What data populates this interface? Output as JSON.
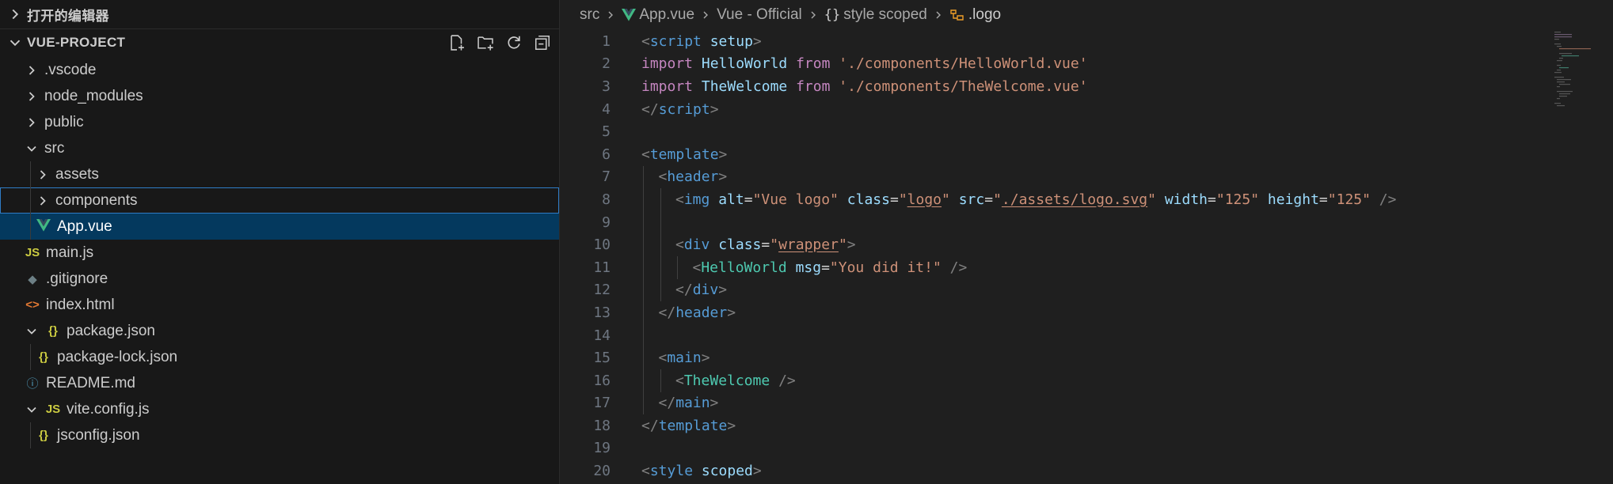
{
  "sidebar": {
    "open_editors_label": "打开的编辑器",
    "project_label": "VUE-PROJECT",
    "tree": [
      {
        "label": ".vscode",
        "indent": 0,
        "kind": "folder",
        "icon": "chevron-right-icon",
        "icon_text": ""
      },
      {
        "label": "node_modules",
        "indent": 0,
        "kind": "folder",
        "icon": "chevron-right-icon",
        "icon_text": ""
      },
      {
        "label": "public",
        "indent": 0,
        "kind": "folder",
        "icon": "chevron-right-icon",
        "icon_text": ""
      },
      {
        "label": "src",
        "indent": 0,
        "kind": "folder-open",
        "icon": "chevron-down-icon",
        "icon_text": ""
      },
      {
        "label": "assets",
        "indent": 1,
        "kind": "folder",
        "icon": "chevron-right-icon",
        "icon_text": ""
      },
      {
        "label": "components",
        "indent": 1,
        "kind": "folder",
        "icon": "chevron-right-icon",
        "icon_text": "",
        "state": "focus"
      },
      {
        "label": "App.vue",
        "indent": 1,
        "kind": "file",
        "icon": "vue-icon",
        "icon_text": "",
        "state": "selected"
      },
      {
        "label": "main.js",
        "indent": 0,
        "kind": "file",
        "icon": "js-icon",
        "icon_text": "JS"
      },
      {
        "label": ".gitignore",
        "indent": 0,
        "kind": "file",
        "icon": "git-icon",
        "icon_text": "◆"
      },
      {
        "label": "index.html",
        "indent": 0,
        "kind": "file",
        "icon": "html-icon",
        "icon_text": "<>"
      },
      {
        "label": "package.json",
        "indent": 0,
        "kind": "file-nested",
        "icon": "json-icon",
        "icon_text": "{}"
      },
      {
        "label": "package-lock.json",
        "indent": 1,
        "kind": "file",
        "icon": "json-icon",
        "icon_text": "{}"
      },
      {
        "label": "README.md",
        "indent": 0,
        "kind": "file",
        "icon": "info-icon",
        "icon_text": "ⓘ"
      },
      {
        "label": "vite.config.js",
        "indent": 0,
        "kind": "file-nested",
        "icon": "js-icon",
        "icon_text": "JS"
      },
      {
        "label": "jsconfig.json",
        "indent": 1,
        "kind": "file",
        "icon": "json-icon",
        "icon_text": "{}"
      }
    ]
  },
  "breadcrumb": {
    "items": [
      "src",
      "App.vue",
      "Vue - Official",
      "style scoped",
      ".logo"
    ]
  },
  "colors": {
    "tag": "#569cd6",
    "punct": "#808080",
    "attr": "#9cdcfe",
    "string": "#ce9178",
    "component": "#4ec9b0",
    "keyword": "#c586c0",
    "ident": "#9cdcfe",
    "plain": "#d4d4d4",
    "vue_green": "#41b883",
    "js_yellow": "#cbcb41",
    "json_yellow": "#cbcb41",
    "html_orange": "#e37933",
    "info_blue": "#519aba"
  },
  "code": {
    "lines": [
      {
        "n": "1",
        "indent": 0,
        "tokens": [
          [
            "punct",
            "<"
          ],
          [
            "tag",
            "script"
          ],
          [
            "plain",
            " "
          ],
          [
            "attr",
            "setup"
          ],
          [
            "punct",
            ">"
          ]
        ]
      },
      {
        "n": "2",
        "indent": 0,
        "tokens": [
          [
            "keyword",
            "import"
          ],
          [
            "plain",
            " "
          ],
          [
            "ident",
            "HelloWorld"
          ],
          [
            "plain",
            " "
          ],
          [
            "keyword",
            "from"
          ],
          [
            "plain",
            " "
          ],
          [
            "string",
            "'./components/HelloWorld.vue'"
          ]
        ]
      },
      {
        "n": "3",
        "indent": 0,
        "tokens": [
          [
            "keyword",
            "import"
          ],
          [
            "plain",
            " "
          ],
          [
            "ident",
            "TheWelcome"
          ],
          [
            "plain",
            " "
          ],
          [
            "keyword",
            "from"
          ],
          [
            "plain",
            " "
          ],
          [
            "string",
            "'./components/TheWelcome.vue'"
          ]
        ]
      },
      {
        "n": "4",
        "indent": 0,
        "tokens": [
          [
            "punct",
            "</"
          ],
          [
            "tag",
            "script"
          ],
          [
            "punct",
            ">"
          ]
        ]
      },
      {
        "n": "5",
        "indent": 0,
        "tokens": []
      },
      {
        "n": "6",
        "indent": 0,
        "tokens": [
          [
            "punct",
            "<"
          ],
          [
            "tag",
            "template"
          ],
          [
            "punct",
            ">"
          ]
        ]
      },
      {
        "n": "7",
        "indent": 1,
        "tokens": [
          [
            "punct",
            "<"
          ],
          [
            "tag",
            "header"
          ],
          [
            "punct",
            ">"
          ]
        ]
      },
      {
        "n": "8",
        "indent": 2,
        "tokens": [
          [
            "punct",
            "<"
          ],
          [
            "tag",
            "img"
          ],
          [
            "plain",
            " "
          ],
          [
            "attr",
            "alt"
          ],
          [
            "plain",
            "="
          ],
          [
            "string",
            "\"Vue logo\""
          ],
          [
            "plain",
            " "
          ],
          [
            "attr",
            "class"
          ],
          [
            "plain",
            "="
          ],
          [
            "string",
            "\""
          ],
          [
            "stringu",
            "logo"
          ],
          [
            "string",
            "\""
          ],
          [
            "plain",
            " "
          ],
          [
            "attr",
            "src"
          ],
          [
            "plain",
            "="
          ],
          [
            "string",
            "\""
          ],
          [
            "stringu",
            "./assets/logo.svg"
          ],
          [
            "string",
            "\""
          ],
          [
            "plain",
            " "
          ],
          [
            "attr",
            "width"
          ],
          [
            "plain",
            "="
          ],
          [
            "string",
            "\"125\""
          ],
          [
            "plain",
            " "
          ],
          [
            "attr",
            "height"
          ],
          [
            "plain",
            "="
          ],
          [
            "string",
            "\"125\""
          ],
          [
            "plain",
            " "
          ],
          [
            "punct",
            "/>"
          ]
        ]
      },
      {
        "n": "9",
        "indent": 2,
        "tokens": []
      },
      {
        "n": "10",
        "indent": 2,
        "tokens": [
          [
            "punct",
            "<"
          ],
          [
            "tag",
            "div"
          ],
          [
            "plain",
            " "
          ],
          [
            "attr",
            "class"
          ],
          [
            "plain",
            "="
          ],
          [
            "string",
            "\""
          ],
          [
            "stringu",
            "wrapper"
          ],
          [
            "string",
            "\""
          ],
          [
            "punct",
            ">"
          ]
        ]
      },
      {
        "n": "11",
        "indent": 3,
        "tokens": [
          [
            "punct",
            "<"
          ],
          [
            "component",
            "HelloWorld"
          ],
          [
            "plain",
            " "
          ],
          [
            "attr",
            "msg"
          ],
          [
            "plain",
            "="
          ],
          [
            "string",
            "\"You did it!\""
          ],
          [
            "plain",
            " "
          ],
          [
            "punct",
            "/>"
          ]
        ]
      },
      {
        "n": "12",
        "indent": 2,
        "tokens": [
          [
            "punct",
            "</"
          ],
          [
            "tag",
            "div"
          ],
          [
            "punct",
            ">"
          ]
        ]
      },
      {
        "n": "13",
        "indent": 1,
        "tokens": [
          [
            "punct",
            "</"
          ],
          [
            "tag",
            "header"
          ],
          [
            "punct",
            ">"
          ]
        ]
      },
      {
        "n": "14",
        "indent": 1,
        "tokens": []
      },
      {
        "n": "15",
        "indent": 1,
        "tokens": [
          [
            "punct",
            "<"
          ],
          [
            "tag",
            "main"
          ],
          [
            "punct",
            ">"
          ]
        ]
      },
      {
        "n": "16",
        "indent": 2,
        "tokens": [
          [
            "punct",
            "<"
          ],
          [
            "component",
            "TheWelcome"
          ],
          [
            "plain",
            " "
          ],
          [
            "punct",
            "/>"
          ]
        ]
      },
      {
        "n": "17",
        "indent": 1,
        "tokens": [
          [
            "punct",
            "</"
          ],
          [
            "tag",
            "main"
          ],
          [
            "punct",
            ">"
          ]
        ]
      },
      {
        "n": "18",
        "indent": 0,
        "tokens": [
          [
            "punct",
            "</"
          ],
          [
            "tag",
            "template"
          ],
          [
            "punct",
            ">"
          ]
        ]
      },
      {
        "n": "19",
        "indent": 0,
        "tokens": []
      },
      {
        "n": "20",
        "indent": 0,
        "tokens": [
          [
            "punct",
            "<"
          ],
          [
            "tag",
            "style"
          ],
          [
            "plain",
            " "
          ],
          [
            "attr",
            "scoped"
          ],
          [
            "punct",
            ">"
          ]
        ]
      }
    ]
  }
}
